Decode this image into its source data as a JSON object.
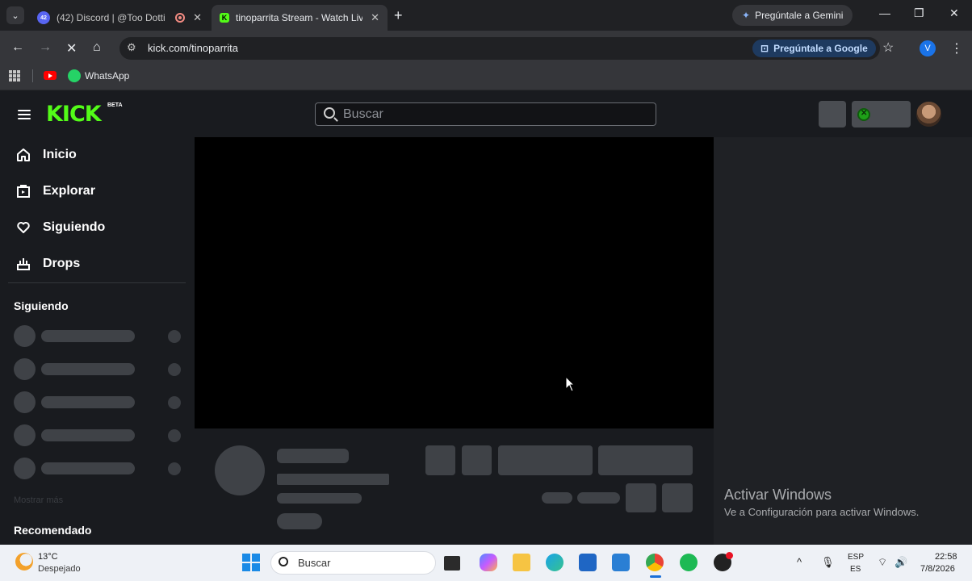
{
  "browser": {
    "tabs": [
      {
        "title": "(42) Discord | @Too Dotti",
        "badge": "42",
        "recording": true
      },
      {
        "title": "tinoparrita Stream - Watch Live",
        "active": true
      }
    ],
    "new_tab": "+",
    "gemini_button": "Pregúntale a Gemini",
    "window_controls": {
      "minimize": "—",
      "restore": "❐",
      "close": "✕"
    },
    "url": "kick.com/tinoparrita",
    "lens_button": "Pregúntale a Google",
    "profile_initial": "V",
    "bookmarks": [
      {
        "label": "WhatsApp"
      }
    ]
  },
  "kick": {
    "logo": "KICK",
    "beta": "BETA",
    "search_placeholder": "Buscar",
    "nav": [
      {
        "label": "Inicio",
        "icon": "home-icon"
      },
      {
        "label": "Explorar",
        "icon": "explore-icon"
      },
      {
        "label": "Siguiendo",
        "icon": "heart-icon"
      },
      {
        "label": "Drops",
        "icon": "drops-icon"
      }
    ],
    "following_title": "Siguiendo",
    "show_more": "Mostrar más",
    "recommended_title": "Recomendado",
    "accent": "#53fc18"
  },
  "watermark": {
    "line1": "Activar Windows",
    "line2": "Ve a Configuración para activar Windows."
  },
  "taskbar": {
    "temperature": "13°C",
    "condition": "Despejado",
    "search_placeholder": "Buscar",
    "lang": "ESP",
    "lang_sub": "ES",
    "time": "22:58",
    "date": "7/8/2026"
  }
}
